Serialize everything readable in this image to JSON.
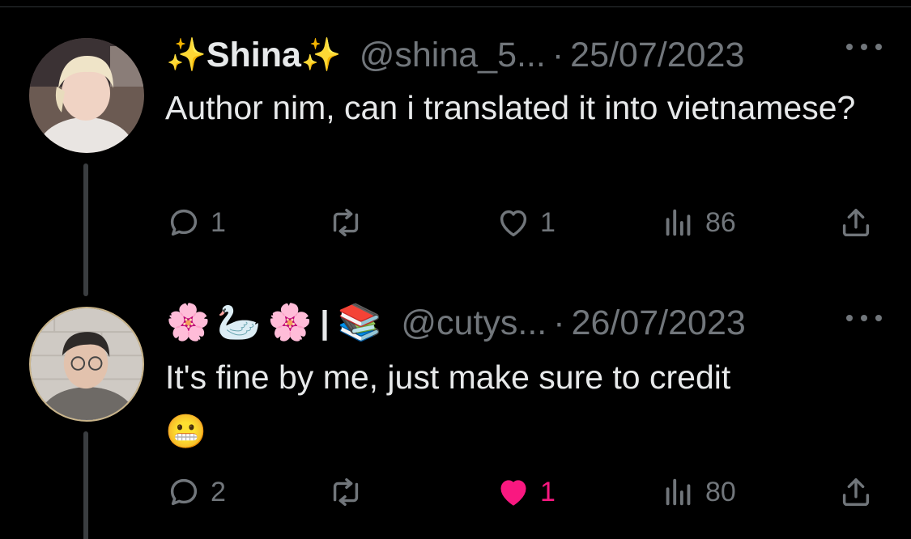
{
  "tweets": [
    {
      "display_name": "Shina",
      "name_prefix_icon": "sparkles",
      "name_suffix_icon": "sparkles",
      "handle": "@shina_5...",
      "separator": "·",
      "date": "25/07/2023",
      "text": "Author nim, can i translated it into vietnamese?",
      "text_emoji": "",
      "actions": {
        "replies": "1",
        "retweets": "",
        "likes": "1",
        "liked": false,
        "views": "86"
      }
    },
    {
      "display_name_emojis": [
        "🌸",
        "🦢",
        "🌸"
      ],
      "name_separator": "|",
      "name_emoji_suffix": "📚",
      "handle": "@cutys...",
      "separator": "·",
      "date": "26/07/2023",
      "text": "It's fine by me, just make sure to credit",
      "text_emoji": "😬",
      "actions": {
        "replies": "2",
        "retweets": "",
        "likes": "1",
        "liked": true,
        "views": "80"
      }
    }
  ],
  "colors": {
    "background": "#000000",
    "text_primary": "#e7e9ea",
    "text_secondary": "#71767b",
    "like_active": "#f91880",
    "sparkle": "#f5c518"
  }
}
